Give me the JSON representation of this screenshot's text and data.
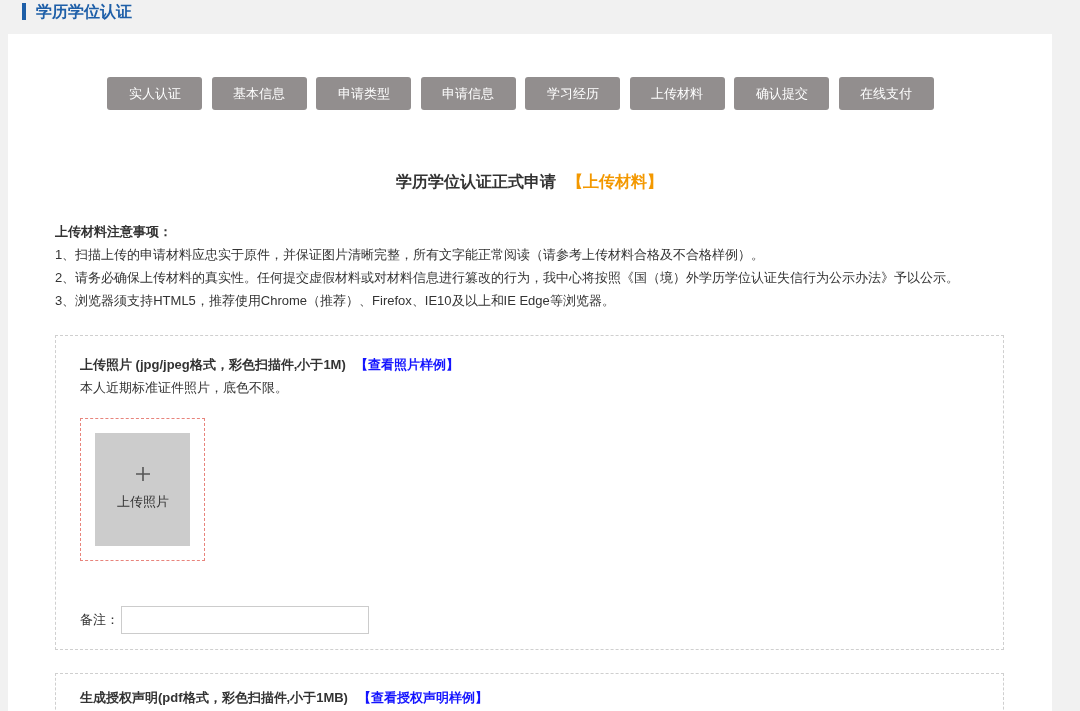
{
  "header": {
    "title": "学历学位认证"
  },
  "steps": [
    {
      "label": "实人认证"
    },
    {
      "label": "基本信息"
    },
    {
      "label": "申请类型"
    },
    {
      "label": "申请信息"
    },
    {
      "label": "学习经历"
    },
    {
      "label": "上传材料"
    },
    {
      "label": "确认提交"
    },
    {
      "label": "在线支付"
    }
  ],
  "form_title": {
    "text": "学历学位认证正式申请",
    "stage": "【上传材料】"
  },
  "notes": {
    "heading": "上传材料注意事项：",
    "items": [
      "1、扫描上传的申请材料应忠实于原件，并保证图片清晰完整，所有文字能正常阅读（请参考上传材料合格及不合格样例）。",
      "2、请务必确保上传材料的真实性。任何提交虚假材料或对材料信息进行篡改的行为，我中心将按照《国（境）外学历学位认证失信行为公示办法》予以公示。",
      "3、浏览器须支持HTML5，推荐使用Chrome（推荐）、Firefox、IE10及以上和IE Edge等浏览器。"
    ]
  },
  "sections": [
    {
      "title": "上传照片 (jpg/jpeg格式，彩色扫描件,小于1M)",
      "link": "【查看照片样例】",
      "description": "本人近期标准证件照片，底色不限。",
      "upload": {
        "label": "上传照片"
      },
      "remark": {
        "label": "备注："
      }
    },
    {
      "title": "生成授权声明(pdf格式，彩色扫描件,小于1MB)",
      "link": "【查看授权声明样例】"
    }
  ]
}
